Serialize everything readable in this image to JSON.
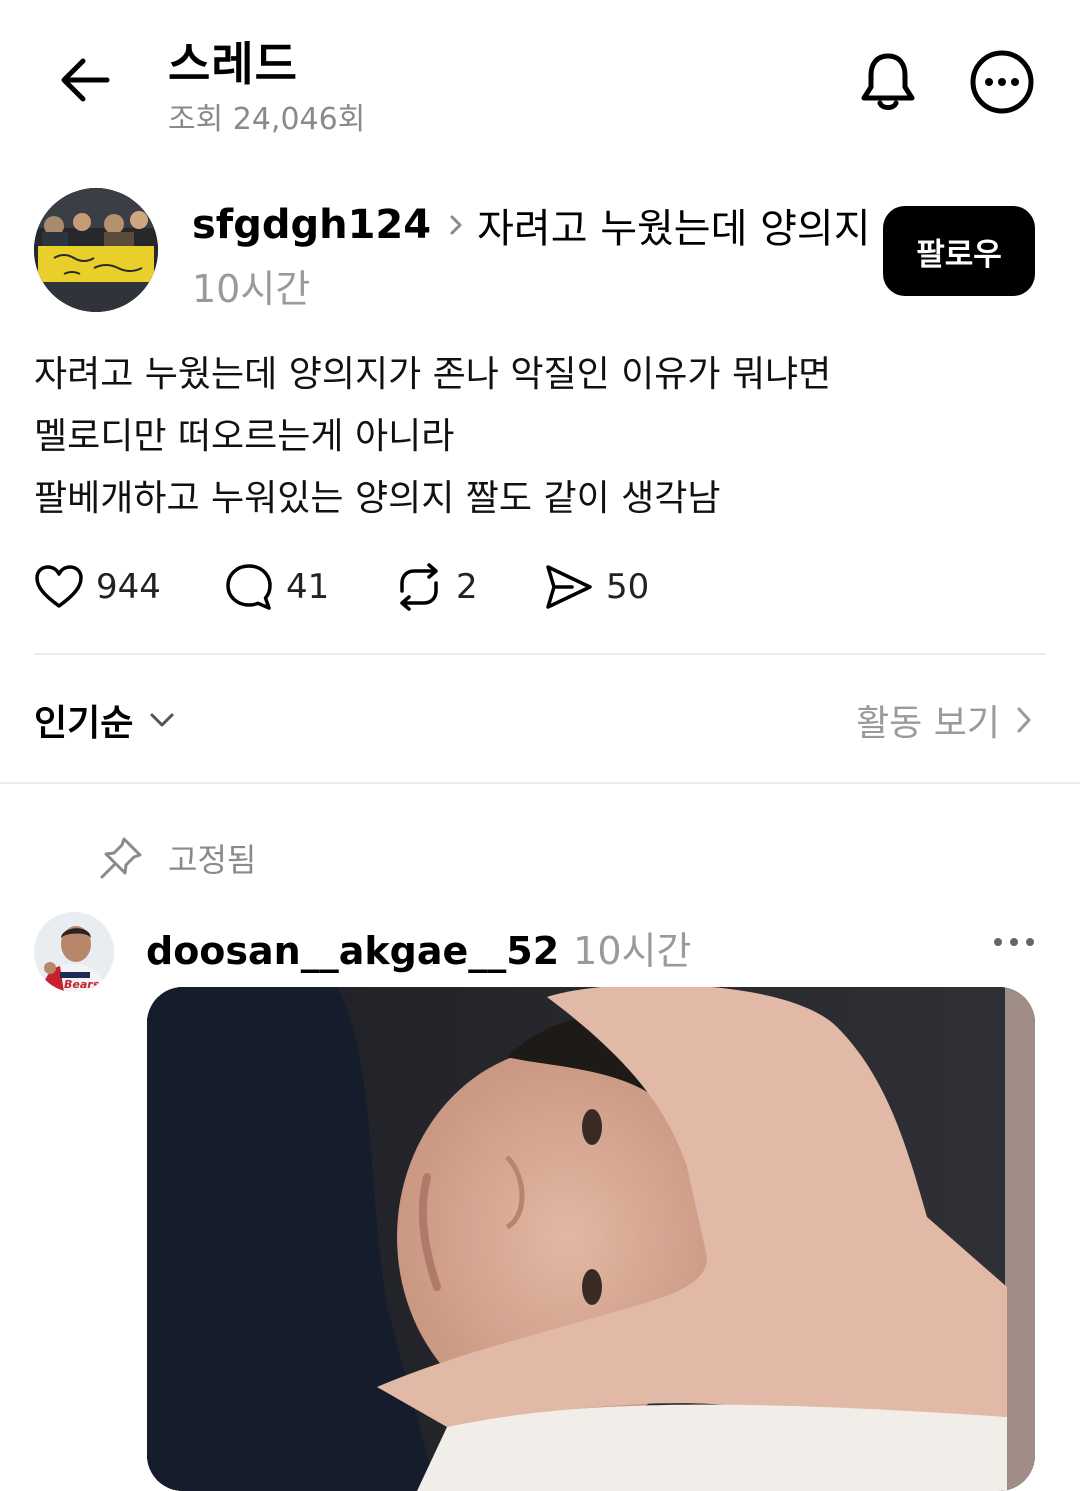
{
  "header": {
    "title": "스레드",
    "views": "조회 24,046회",
    "back_icon": "arrow-left-icon",
    "bell_icon": "bell-icon",
    "more_icon": "more-circle-icon"
  },
  "post": {
    "author": "sfgdgh124",
    "topic": "자려고 누웠는데 양의지",
    "time": "10시간",
    "follow_label": "팔로우",
    "body_lines": [
      "자려고 누웠는데 양의지가 존나 악질인 이유가 뭐냐면",
      "멜로디만 떠오르는게 아니라",
      "팔베개하고 누워있는 양의지 짤도 같이 생각남"
    ],
    "counts": {
      "likes": "944",
      "comments": "41",
      "reposts": "2",
      "shares": "50"
    }
  },
  "sort": {
    "label": "인기순",
    "activity_label": "활동 보기"
  },
  "reply": {
    "pinned_label": "고정됨",
    "author": "doosan__akgae__52",
    "time": "10시간"
  },
  "colors": {
    "text": "#000000",
    "muted": "#8a8a8a",
    "divider": "#ececec",
    "follow_bg": "#000000",
    "follow_text": "#ffffff"
  }
}
